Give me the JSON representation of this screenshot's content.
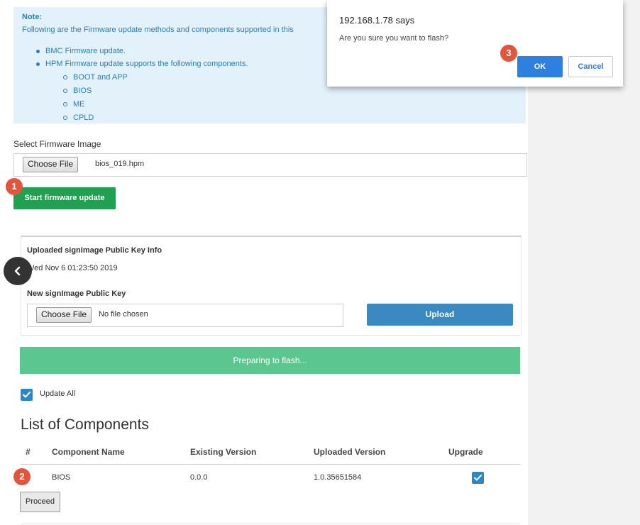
{
  "note": {
    "title": "Note:",
    "body": "Following are the Firmware update methods and components supported in this",
    "items": [
      "BMC Firmware update.",
      "HPM Firmware update supports the following components."
    ],
    "subitems": [
      "BOOT and APP",
      "BIOS",
      "ME",
      "CPLD"
    ]
  },
  "firmware": {
    "section_label": "Select Firmware Image",
    "choose_label": "Choose File",
    "file_name": "bios_019.hpm",
    "start_label": "Start firmware update"
  },
  "key": {
    "uploaded_label": "Uploaded signImage Public Key Info",
    "uploaded_date": "Wed Nov 6 01:23:50 2019",
    "new_label": "New signImage Public Key",
    "choose_label": "Choose File",
    "file_name": "No file chosen",
    "upload_label": "Upload"
  },
  "progress": {
    "text": "Preparing to flash..."
  },
  "update_all": {
    "label": "Update All",
    "checked": true
  },
  "components": {
    "title": "List of Components",
    "headers": [
      "#",
      "Component Name",
      "Existing Version",
      "Uploaded Version",
      "Upgrade"
    ],
    "rows": [
      {
        "name": "BIOS",
        "existing": "0.0.0",
        "uploaded": "1.0.35651584",
        "upgrade": true
      }
    ],
    "proceed_label": "Proceed"
  },
  "dialog": {
    "title": "192.168.1.78 says",
    "message": "Are you sure you want to flash?",
    "ok_label": "OK",
    "cancel_label": "Cancel"
  },
  "markers": [
    "1",
    "2",
    "3"
  ],
  "colors": {
    "note_bg": "#e3f1fb",
    "note_text": "#2a7db5",
    "start_button": "#1fa151",
    "upload_button": "#3b89c1",
    "progress_bar": "#5cc690",
    "checkbox": "#2d86c7",
    "marker": "#e2553a",
    "ok_button": "#2d7fe0"
  },
  "icons": {
    "back": "chevron-left-icon",
    "check": "check-icon"
  }
}
